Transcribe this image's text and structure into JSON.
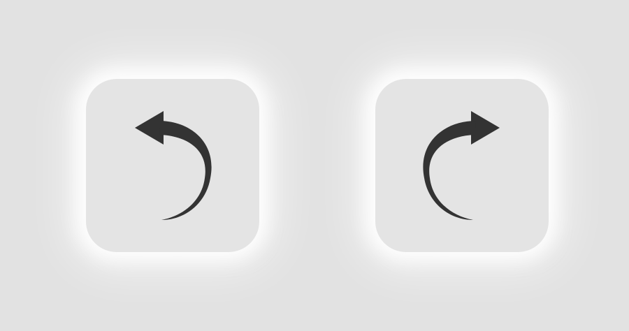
{
  "buttons": [
    {
      "id": "undo",
      "icon": "undo-arrow-icon"
    },
    {
      "id": "redo",
      "icon": "redo-arrow-icon"
    }
  ],
  "colors": {
    "background": "#e2e2e2",
    "button_face": "#e4e4e4",
    "icon": "#333333"
  }
}
